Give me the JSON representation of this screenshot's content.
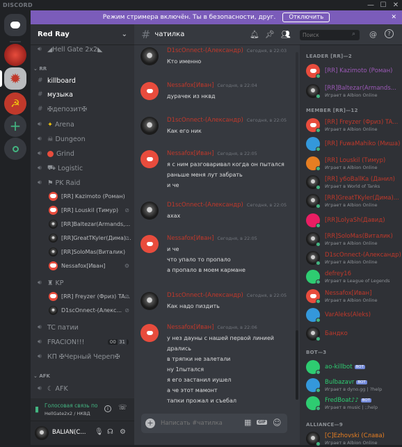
{
  "app": {
    "brand": "DISCORD"
  },
  "window_controls": {
    "minimize": "—",
    "maximize": "☐",
    "close": "✕"
  },
  "banner": {
    "text": "Режим стримера включён. Ты в безопасности, друг.",
    "button": "Отключить",
    "close": "✕"
  },
  "server": {
    "name": "Red Ray",
    "chevron": "⌄"
  },
  "channels": {
    "top": "◢Hell Gate 2x2◣",
    "category_rr": "RR",
    "text": [
      {
        "label": "killboard",
        "bright": true
      },
      {
        "label": "музыка",
        "bright": true
      },
      {
        "label": "✠депозит✠",
        "bright": false
      }
    ],
    "voice": [
      {
        "label": "Arena"
      },
      {
        "label": "Dungeon"
      },
      {
        "label": "Grind"
      },
      {
        "label": "Logistic"
      },
      {
        "label": "PK Raid"
      }
    ],
    "pk_users": [
      {
        "name": "[RR] Kazimoto (Роман)",
        "icon": ""
      },
      {
        "name": "[RR] Louskil (Тимур)",
        "icon": "🎤"
      },
      {
        "name": "[RR]Baltezar(Armands,...",
        "icon": ""
      },
      {
        "name": "[RR]GreatTKyler(Дима)...",
        "icon": "🎤"
      },
      {
        "name": "[RR]SoloMas(Виталик)",
        "icon": ""
      },
      {
        "name": "Nessafox[Иван]",
        "icon": "⚙"
      }
    ],
    "kp": {
      "label": "KP"
    },
    "kp_users": [
      {
        "name": "[RR] Freyzer (Фриз) TA...",
        "icon": "🎤"
      },
      {
        "name": "D1scOnnect-(Алекс...",
        "icon": "🎤"
      }
    ],
    "tc": "TC патии",
    "fracion": "FRACION!!!",
    "fracion_badge_a": "00",
    "fracion_badge_b": "31",
    "kp2": "КП ✠Черный Череп✠",
    "category_afk": "AFK",
    "afk": "AFK"
  },
  "voice_status": {
    "title": "Голосовая связь по",
    "sub": "HellGate2x2 / НКВД"
  },
  "user": {
    "name": "BALIAN(C..."
  },
  "chat": {
    "channel": "чатилка",
    "search_placeholder": "Поиск",
    "input_placeholder": "Написать #чатилка",
    "messages": [
      {
        "name": "D1scOnnect-(Александр)",
        "ts": "Сегодня, в 22:03",
        "lines": [
          "Кто именно"
        ],
        "av": "photo"
      },
      {
        "name": "Nessafox[Иван]",
        "ts": "Сегодня, в 22:04",
        "lines": [
          "дурачек из нквд"
        ],
        "av": "disc"
      },
      {
        "name": "D1scOnnect-(Александр)",
        "ts": "Сегодня, в 22:05",
        "lines": [
          "Как его ник"
        ],
        "av": "photo"
      },
      {
        "name": "Nessafox[Иван]",
        "ts": "Сегодня, в 22:05",
        "lines": [
          "я с ним разговаривал когда он пытался",
          "раньше меня лут забрать",
          "и че"
        ],
        "av": "disc"
      },
      {
        "name": "D1scOnnect-(Александр)",
        "ts": "Сегодня, в 22:05",
        "lines": [
          "ахах"
        ],
        "av": "photo"
      },
      {
        "name": "Nessafox[Иван]",
        "ts": "Сегодня, в 22:05",
        "lines": [
          "и че",
          "что упало то пропало",
          "а пропало в моем кармане"
        ],
        "av": "disc"
      },
      {
        "name": "D1scOnnect-(Александр)",
        "ts": "Сегодня, в 22:05",
        "lines": [
          "Как надо пиздить"
        ],
        "av": "photo"
      },
      {
        "name": "Nessafox[Иван]",
        "ts": "Сегодня, в 22:06",
        "lines": [
          "у нез дауны с нашей первой линией",
          "дрались",
          "в тряпки не залетали",
          "ну 1пытался",
          "я его застанил иушел",
          "а че этот мамонт",
          "тапки прожал и съебал"
        ],
        "av": "disc"
      }
    ]
  },
  "members": {
    "leader_header": "LEADER [RR]—2",
    "leaders": [
      {
        "name": "[RR] Kazimoto (Роман)",
        "color": "#9b59b6",
        "activity": "",
        "av": "disc"
      },
      {
        "name": "[RR]Baltezar(Armands...",
        "color": "#9b59b6",
        "activity": "Играет в Albion Online",
        "av": "photo"
      }
    ],
    "member_header": "MEMBER [RR]—12",
    "list": [
      {
        "name": "[RR] Freyzer (Фриз) TA...",
        "activity": "Играет в Albion Online",
        "av": "disc"
      },
      {
        "name": "[RR] FuwaMahiko (Миша)",
        "activity": "",
        "av": "blue"
      },
      {
        "name": "[RR] Louskil (Тимур)",
        "activity": "Играет в Albion Online",
        "av": "orange"
      },
      {
        "name": "[RR] y6oBallKa (Данил)",
        "activity": "Играет в World of Tanks",
        "av": "photo"
      },
      {
        "name": "[RR]GreatTKyler(Дима)...",
        "activity": "Играет в Albion Online",
        "av": "photo"
      },
      {
        "name": "[RR]LolyaSh(Давид)",
        "activity": "",
        "av": "pink"
      },
      {
        "name": "[RR]SoloMas(Виталик)",
        "activity": "Играет в Albion Online",
        "av": "photo"
      },
      {
        "name": "D1scOnnect-(Александр)",
        "activity": "Играет в Albion Online",
        "av": "photo"
      },
      {
        "name": "defrey16",
        "activity": "Играет в League of Legends",
        "av": "green"
      },
      {
        "name": "Nessafox[Иван]",
        "activity": "Играет в Albion Online",
        "av": "disc"
      },
      {
        "name": "VarAleks(Aleks)",
        "activity": "",
        "av": "blue"
      },
      {
        "name": "Бандко",
        "activity": "",
        "av": "photo"
      }
    ],
    "bot_header": "BOT—3",
    "bots": [
      {
        "name": "ao-killbot",
        "activity": "",
        "color": "#2ecc71",
        "av": "green"
      },
      {
        "name": "Bulbazavr",
        "activity": "Играет в dyno.gg | ?help",
        "color": "#2ecc71",
        "av": "blue"
      },
      {
        "name": "FredBoat♪♪",
        "activity": "Играет в music | ;;help",
        "color": "#2ecc71",
        "av": "green"
      }
    ],
    "bot_tag": "BOT",
    "alliance_header": "ALLIANCE—9",
    "alliance": [
      {
        "name": "[C]Ezhovski (Слава)",
        "activity": "Играет в Albion Online",
        "color": "#e67e22",
        "av": "photo"
      }
    ]
  },
  "colors": {
    "member": "#c0392b",
    "accent": "#7289da",
    "online": "#43b581",
    "banner": "#7b5cba"
  }
}
